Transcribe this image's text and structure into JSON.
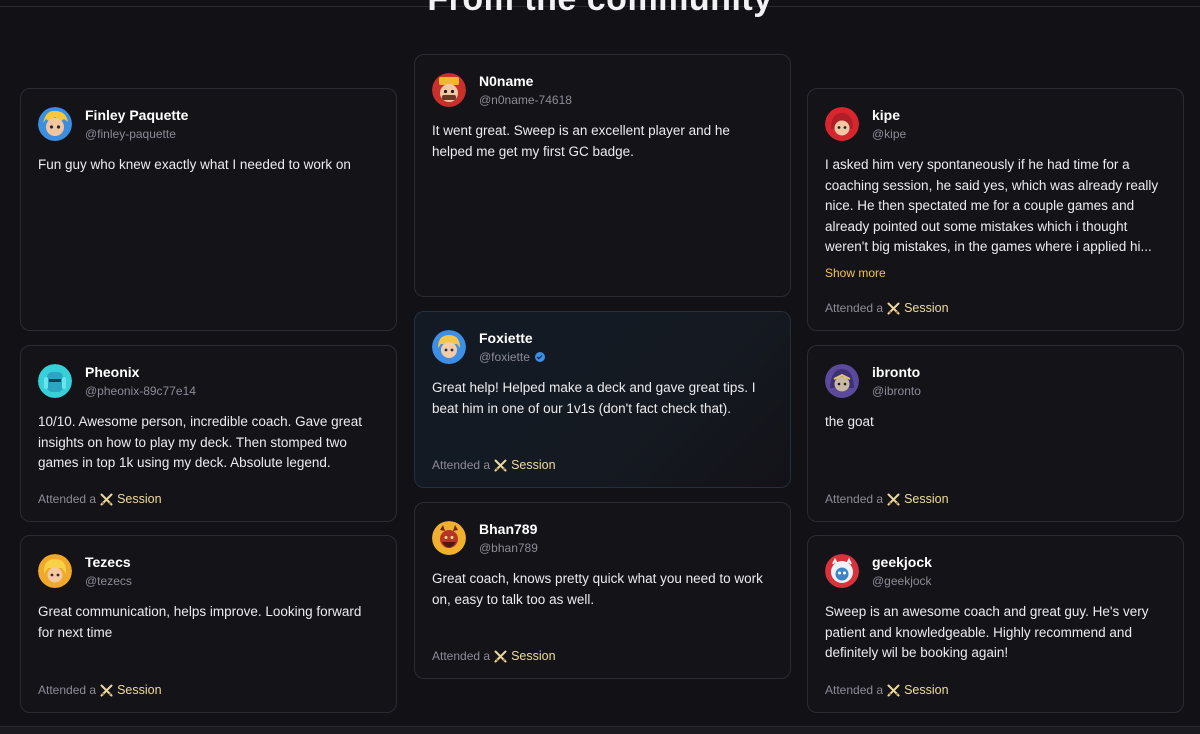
{
  "section": {
    "title": "From the community"
  },
  "reviews": [
    {
      "name": "Finley Paquette",
      "handle": "@finley-paquette",
      "text": "Fun guy who knew exactly what I needed to work on",
      "attended": "",
      "session": "",
      "show_more": "",
      "avatar": "blonde-character-avatar"
    },
    {
      "name": "N0name",
      "handle": "@n0name-74618",
      "text": "It went great. Sweep is an excellent player and he helped me get my first GC badge.",
      "attended": "",
      "session": "",
      "show_more": "",
      "avatar": "red-king-avatar"
    },
    {
      "name": "kipe",
      "handle": "@kipe",
      "text": "I asked him very spontaneously if he had time for a coaching session, he said yes, which was already really nice. He then spectated me for a couple games and already pointed out some mistakes which i thought weren't big mistakes, in the games where i applied hi...",
      "show_more": "Show more",
      "attended": "Attended a",
      "session": "Session",
      "avatar": "red-hood-avatar"
    },
    {
      "name": "Pheonix",
      "handle": "@pheonix-89c77e14",
      "text": "10/10. Awesome person, incredible coach. Gave great insights on how to play my deck. Then stomped two games in top 1k using my deck. Absolute legend.",
      "attended": "Attended a",
      "session": "Session",
      "show_more": "",
      "avatar": "cyan-knight-avatar"
    },
    {
      "name": "Foxiette",
      "handle": "@foxiette",
      "verified": true,
      "text": "Great help! Helped make a deck and gave great tips. I beat him in one of our 1v1s (don't fact check that).",
      "attended": "Attended a",
      "session": "Session",
      "show_more": "",
      "avatar": "blue-princess-avatar"
    },
    {
      "name": "ibronto",
      "handle": "@ibronto",
      "text": "the goat",
      "attended": "Attended a",
      "session": "Session",
      "show_more": "",
      "avatar": "purple-hood-avatar"
    },
    {
      "name": "Tezecs",
      "handle": "@tezecs",
      "text": "Great communication, helps improve. Looking forward for next time",
      "attended": "Attended a",
      "session": "Session",
      "show_more": "",
      "avatar": "golden-knight-avatar"
    },
    {
      "name": "Bhan789",
      "handle": "@bhan789",
      "text": "Great coach, knows pretty quick what you need to work on, easy to talk too as well.",
      "attended": "Attended a",
      "session": "Session",
      "show_more": "",
      "avatar": "bearded-warrior-avatar"
    },
    {
      "name": "geekjock",
      "handle": "@geekjock",
      "text": "Sweep is an awesome coach and great guy. He's very patient and knowledgeable. Highly recommend and definitely wil be booking again!",
      "attended": "Attended a",
      "session": "Session",
      "show_more": "",
      "avatar": "white-yeti-avatar"
    }
  ],
  "colors": {
    "background": "#121116",
    "card": "#141318",
    "border": "#2c2b33",
    "session_gold": "#eddc9a",
    "show_more": "#f5c24a"
  }
}
